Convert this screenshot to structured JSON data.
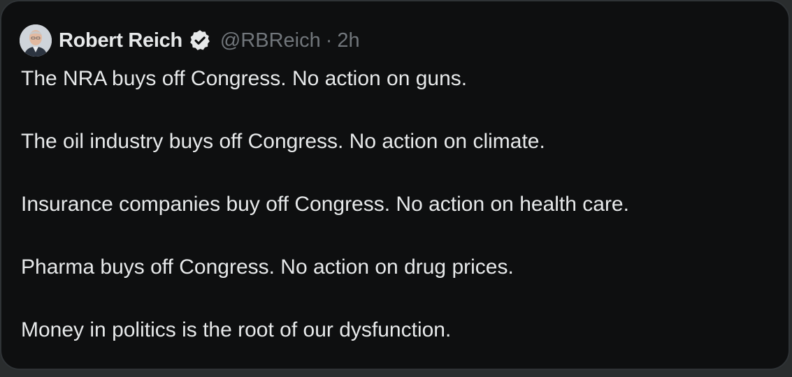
{
  "tweet": {
    "author_name": "Robert Reich",
    "handle": "@RBReich",
    "separator": "·",
    "time": "2h",
    "verified_icon": "verified-badge-icon",
    "avatar": "author-avatar",
    "lines": [
      "The NRA buys off Congress. No action on guns.",
      "The oil industry buys off Congress. No action on climate.",
      "Insurance companies buy off Congress. No action on health care.",
      "Pharma buys off Congress. No action on drug prices.",
      "Money in politics is the root of our dysfunction."
    ]
  },
  "colors": {
    "background": "#0e0f10",
    "border": "#2f3336",
    "text_primary": "#e7e9ea",
    "text_secondary": "#71767b"
  }
}
